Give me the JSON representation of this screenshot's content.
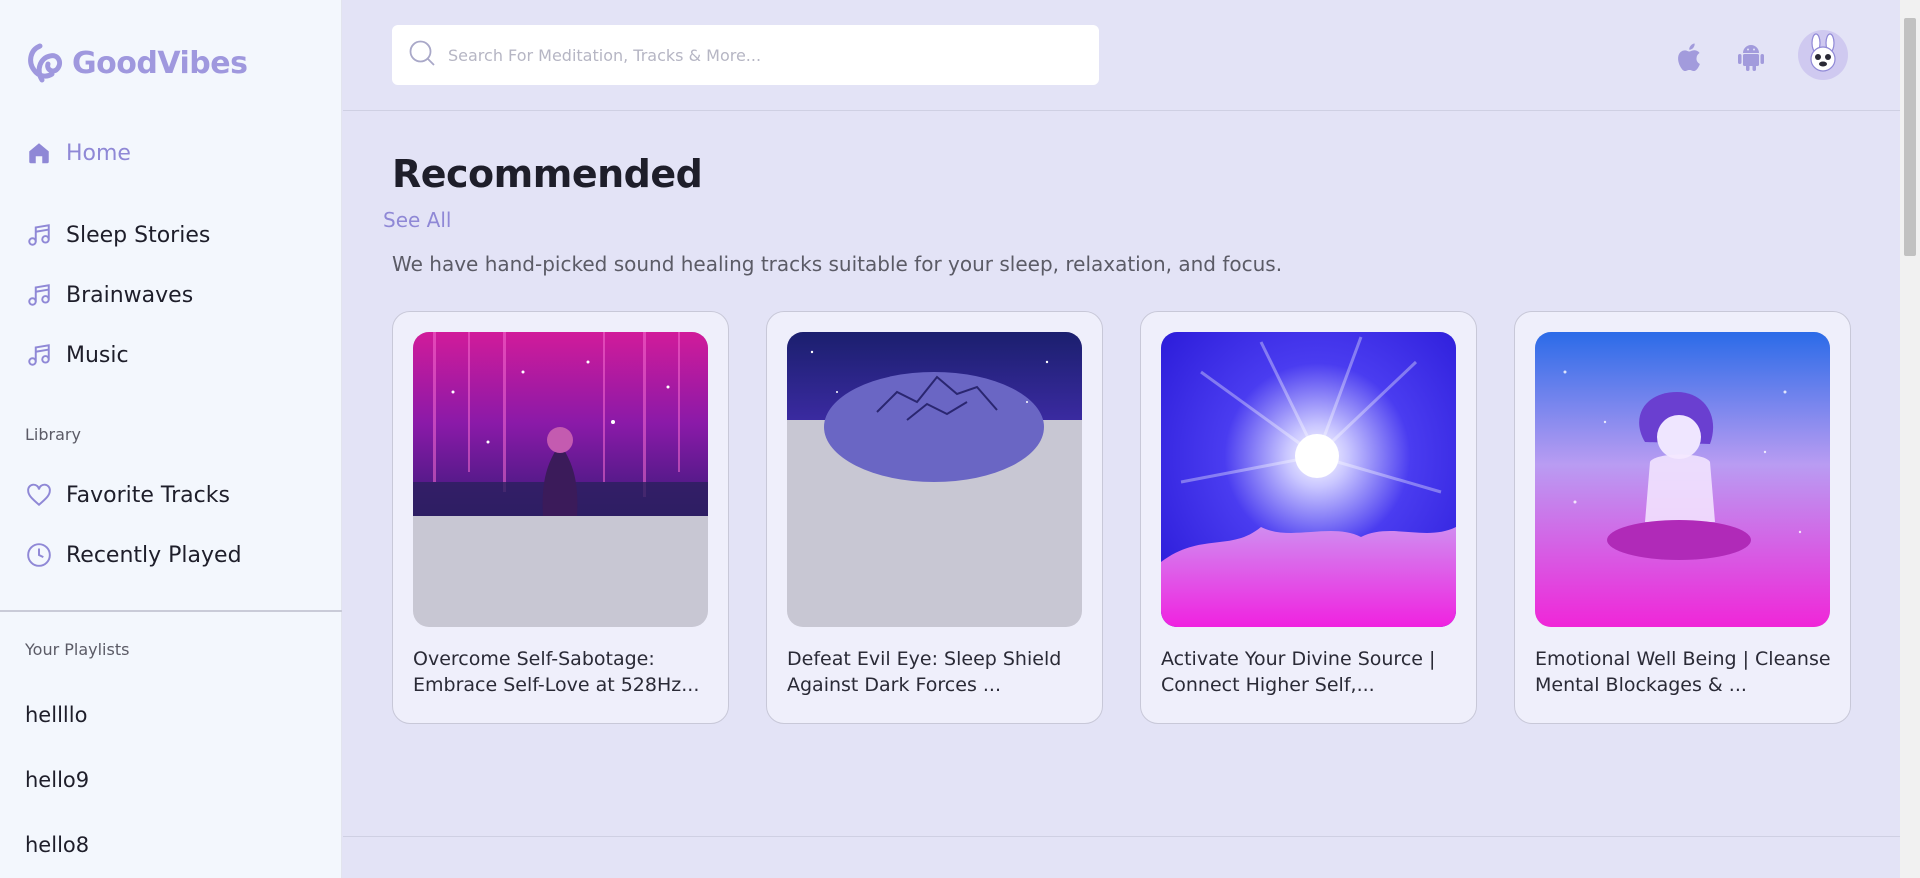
{
  "brand": {
    "name": "GoodVibes",
    "color": "#9f98de"
  },
  "sidebar": {
    "nav": [
      {
        "label": "Home",
        "icon": "home-icon",
        "active": true
      },
      {
        "label": "Sleep Stories",
        "icon": "music-note-icon"
      },
      {
        "label": "Brainwaves",
        "icon": "music-note-icon"
      },
      {
        "label": "Music",
        "icon": "music-note-icon"
      }
    ],
    "library_label": "Library",
    "library": [
      {
        "label": "Favorite Tracks",
        "icon": "heart-icon"
      },
      {
        "label": "Recently Played",
        "icon": "clock-icon"
      }
    ],
    "playlists_label": "Your Playlists",
    "playlists": [
      "hellllo",
      "hello9",
      "hello8"
    ]
  },
  "header": {
    "search_placeholder": "Search For Meditation, Tracks & More...",
    "icons": [
      "apple-icon",
      "android-icon",
      "avatar"
    ]
  },
  "main": {
    "title": "Recommended",
    "see_all": "See All",
    "subtitle": "We have hand-picked sound healing tracks suitable for your sleep, relaxation, and focus.",
    "cards": [
      {
        "title": "Overcome Self-Sabotage: Embrace Self-Love at 528Hz..."
      },
      {
        "title": "Defeat Evil Eye: Sleep Shield Against Dark Forces ..."
      },
      {
        "title": "Activate Your Divine Source | Connect Higher Self,..."
      },
      {
        "title": "Emotional Well Being | Cleanse Mental Blockages & ..."
      }
    ]
  },
  "colors": {
    "accent": "#8f88d6",
    "background": "#e3e3f6",
    "sidebar": "#f3f7fd"
  }
}
